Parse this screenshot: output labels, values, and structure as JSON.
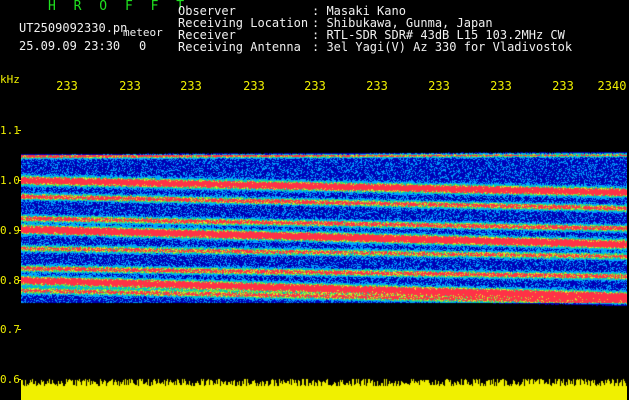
{
  "header": {
    "title": "H R O F F T",
    "file_name": "UT2509092330.pn",
    "meteor_label": "meteor",
    "datetime": "25.09.09 23:30",
    "count": "0",
    "rows": [
      {
        "label": "Observer",
        "value": ": Masaki Kano"
      },
      {
        "label": "Receiving Location",
        "value": ": Shibukawa, Gunma, Japan"
      },
      {
        "label": "Receiver",
        "value": ": RTL-SDR SDR# 43dB L15 103.2MHz CW"
      },
      {
        "label": "Receiving Antenna",
        "value": ": 3el Yagi(V) Az 330 for Vladivostok"
      }
    ]
  },
  "axes": {
    "y_unit": "kHz",
    "x_ticks": [
      "233",
      "233",
      "233",
      "233",
      "233",
      "233",
      "233",
      "233",
      "233",
      "2340"
    ],
    "y_ticks": [
      "1.1",
      "1.0",
      "0.9",
      "0.8",
      "0.7",
      "0.6"
    ]
  },
  "colors": {
    "background": "#000000",
    "axis": "#f0f000",
    "title": "#20e020",
    "text": "#f0f0f0"
  }
}
